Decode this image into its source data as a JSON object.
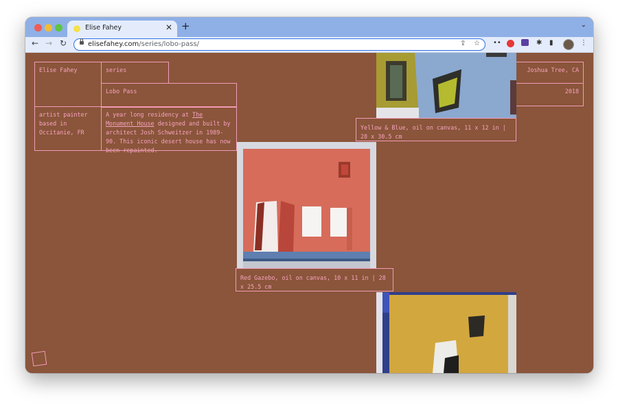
{
  "browser": {
    "tab_title": "Elise Fahey",
    "url_domain": "elisefahey.com",
    "url_path": "/series/lobo-pass/",
    "new_tab_icon": "plus-icon",
    "close_icon": "close-icon"
  },
  "site": {
    "artist_name": "Elise Fahey",
    "section_label": "series",
    "series_title": "Lobo Pass",
    "artist_bio": "artist painter based in Occitanie, FR",
    "description_pre": "A year long residency at ",
    "description_link": "The Monument House",
    "description_post": " designed and built by architect Josh Schweitzer in 1989-90. This iconic desert house has now been repainted.",
    "location": "Joshua Tree, CA",
    "year": "2018"
  },
  "artworks": [
    {
      "caption": "Yellow & Blue, oil on canvas, 11 x 12 in | 28 x 30.5 cm"
    },
    {
      "caption": "Red Gazebo, oil on canvas, 10 x 11 in | 28 x 25.5 cm"
    }
  ],
  "colors": {
    "page_bg": "#8a553b",
    "accent_pink": "#f29bb6",
    "tab_strip": "#8fb0e6"
  }
}
